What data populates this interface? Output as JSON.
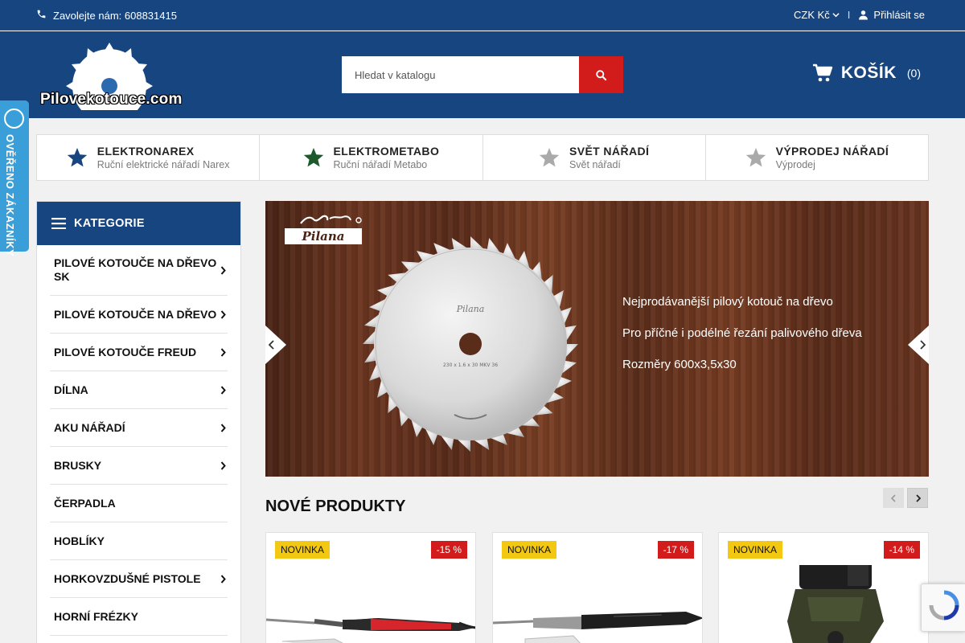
{
  "topbar": {
    "phone_label": "Zavolejte nám: 608831415",
    "currency": "CZK Kč",
    "login": "Přihlásit se",
    "separator": "I"
  },
  "header": {
    "logo_text": "Pilovekotouce.com",
    "search_placeholder": "Hledat v katalogu",
    "cart_label": "KOŠÍK",
    "cart_count": "(0)"
  },
  "badge": {
    "text": "OVĚŘENO ZÁKAZNÍKY"
  },
  "brands": [
    {
      "title": "ELEKTRONAREX",
      "subtitle": "Ruční elektrické nářadí Narex",
      "icon": "star-icon",
      "color": "#17457f"
    },
    {
      "title": "ELEKTROMETABO",
      "subtitle": "Ruční nářadí Metabo",
      "icon": "star-icon",
      "color": "#1c5a2c"
    },
    {
      "title": "SVĚT NÁŘADÍ",
      "subtitle": "Svět nářadí",
      "icon": "star-icon",
      "color": "#aaaaaa"
    },
    {
      "title": "VÝPRODEJ NÁŘADÍ",
      "subtitle": "Výprodej",
      "icon": "star-icon",
      "color": "#aaaaaa"
    }
  ],
  "categories": {
    "title": "KATEGORIE",
    "items": [
      {
        "label": "PILOVÉ KOTOUČE NA DŘEVO SK",
        "has_children": true
      },
      {
        "label": "PILOVÉ KOTOUČE NA DŘEVO",
        "has_children": true
      },
      {
        "label": "PILOVÉ KOTOUČE FREUD",
        "has_children": true
      },
      {
        "label": "DÍLNA",
        "has_children": true
      },
      {
        "label": "AKU NÁŘADÍ",
        "has_children": true
      },
      {
        "label": "BRUSKY",
        "has_children": true
      },
      {
        "label": "ČERPADLA",
        "has_children": false
      },
      {
        "label": "HOBLÍKY",
        "has_children": false
      },
      {
        "label": "HORKOVZDUŠNÉ PISTOLE",
        "has_children": true
      },
      {
        "label": "HORNÍ FRÉZKY",
        "has_children": false
      }
    ]
  },
  "slider": {
    "brand_logo": "Pilana",
    "blade_text": "230 x 1.6 x 30  MKV 36",
    "captions": [
      "Nejprodávanější pilový kotouč na dřevo",
      "Pro příčné i podélné řezání palivového dřeva",
      "Rozměry 600x3,5x30"
    ]
  },
  "new_products": {
    "title": "NOVÉ PRODUKTY",
    "items": [
      {
        "badge": "NOVINKA",
        "discount": "-15 %"
      },
      {
        "badge": "NOVINKA",
        "discount": "-17 %"
      },
      {
        "badge": "NOVINKA",
        "discount": "-14 %"
      }
    ]
  }
}
